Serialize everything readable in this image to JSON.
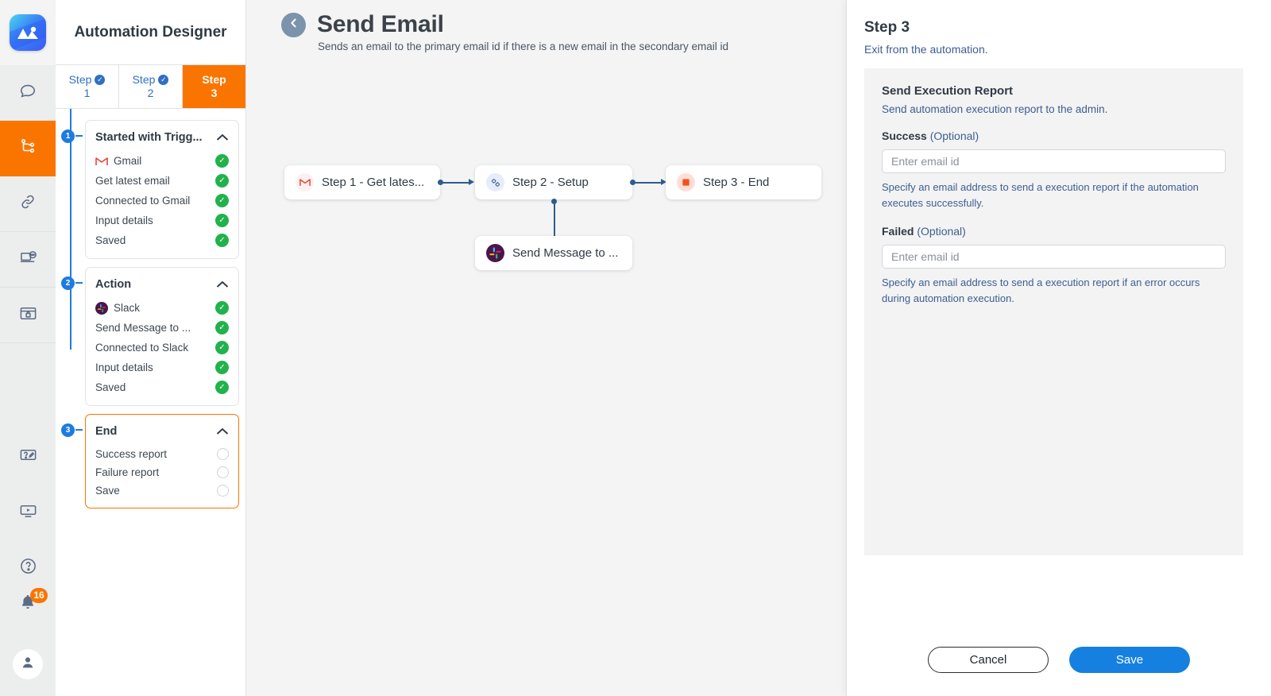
{
  "app": {
    "logo_icon": "image-gallery-logo",
    "panel_title": "Automation Designer"
  },
  "rail": {
    "items": [
      {
        "icon": "chat-bubble-icon",
        "name": "chat"
      },
      {
        "icon": "workflow-branch-icon",
        "name": "automation-designer",
        "active": true
      },
      {
        "icon": "link-chain-icon",
        "name": "connections"
      },
      {
        "icon": "laptop-chat-icon",
        "name": "support"
      },
      {
        "icon": "browser-briefcase-icon",
        "name": "workspace"
      },
      {
        "icon": "quiz-edit-icon",
        "name": "forms"
      },
      {
        "icon": "video-player-icon",
        "name": "tutorials"
      },
      {
        "icon": "help-circle-icon",
        "name": "help"
      }
    ],
    "notifications": {
      "icon": "bell-icon",
      "count": "16"
    },
    "avatar": {
      "icon": "user-avatar-icon"
    }
  },
  "steps_tabs": [
    {
      "label": "Step",
      "number": "1",
      "state": "complete",
      "active": false
    },
    {
      "label": "Step",
      "number": "2",
      "state": "complete",
      "active": false
    },
    {
      "label": "Step",
      "number": "3",
      "state": "current",
      "active": true
    }
  ],
  "step_groups": [
    {
      "badge": "1",
      "title": "Started with Trigg...",
      "accent": false,
      "rows": [
        {
          "label": "Gmail",
          "icon": "gmail-icon",
          "status": "done"
        },
        {
          "label": "Get latest email",
          "icon": null,
          "status": "done"
        },
        {
          "label": "Connected to Gmail",
          "icon": null,
          "status": "done"
        },
        {
          "label": "Input details",
          "icon": null,
          "status": "done"
        },
        {
          "label": "Saved",
          "icon": null,
          "status": "done"
        }
      ]
    },
    {
      "badge": "2",
      "title": "Action",
      "accent": false,
      "rows": [
        {
          "label": "Slack",
          "icon": "slack-icon",
          "status": "done"
        },
        {
          "label": "Send Message to ...",
          "icon": null,
          "status": "done"
        },
        {
          "label": "Connected to Slack",
          "icon": null,
          "status": "done"
        },
        {
          "label": "Input details",
          "icon": null,
          "status": "done"
        },
        {
          "label": "Saved",
          "icon": null,
          "status": "done"
        }
      ]
    },
    {
      "badge": "3",
      "title": "End",
      "accent": true,
      "rows": [
        {
          "label": "Success report",
          "icon": null,
          "status": "pending"
        },
        {
          "label": "Failure report",
          "icon": null,
          "status": "pending"
        },
        {
          "label": "Save",
          "icon": null,
          "status": "pending"
        }
      ]
    }
  ],
  "header": {
    "back_icon": "chevron-left-circle-icon",
    "title": "Send Email",
    "subtitle": "Sends an email to the primary email id if there is a new email in the secondary email id",
    "actions": [
      {
        "name": "run-automation-button",
        "icon": "play-icon"
      },
      {
        "name": "duplicate-automation-button",
        "icon": "copy-icon"
      },
      {
        "name": "publish-automation-button",
        "icon": "send-paper-plane-icon"
      }
    ]
  },
  "flow": {
    "nodes": [
      {
        "id": "n1",
        "label": "Step 1 - Get lates...",
        "icon": "gmail-icon"
      },
      {
        "id": "n2",
        "label": "Step 2 - Setup",
        "icon": "settings-gears-icon"
      },
      {
        "id": "n3",
        "label": "Step 3 - End",
        "icon": "stop-square-icon"
      },
      {
        "id": "n4",
        "label": "Send Message to ...",
        "icon": "slack-icon"
      }
    ]
  },
  "inspector": {
    "title": "Step 3",
    "subtitle": "Exit from the automation.",
    "section_title": "Send Execution Report",
    "section_subtitle": "Send automation execution report to the admin.",
    "fields": [
      {
        "label": "Success",
        "optional": "(Optional)",
        "value": "",
        "placeholder": "Enter email id",
        "help": "Specify an email address to send a execution report if the automation executes successfully."
      },
      {
        "label": "Failed",
        "optional": "(Optional)",
        "value": "",
        "placeholder": "Enter email id",
        "help": "Specify an email address to send a execution report if an error occurs during automation execution."
      }
    ],
    "cancel_label": "Cancel",
    "save_label": "Save"
  },
  "colors": {
    "accent_orange": "#fa7500",
    "accent_blue": "#1e7be0",
    "success_green": "#22b24c",
    "link_blue": "#3c5e93",
    "save_blue": "#1580e0"
  }
}
